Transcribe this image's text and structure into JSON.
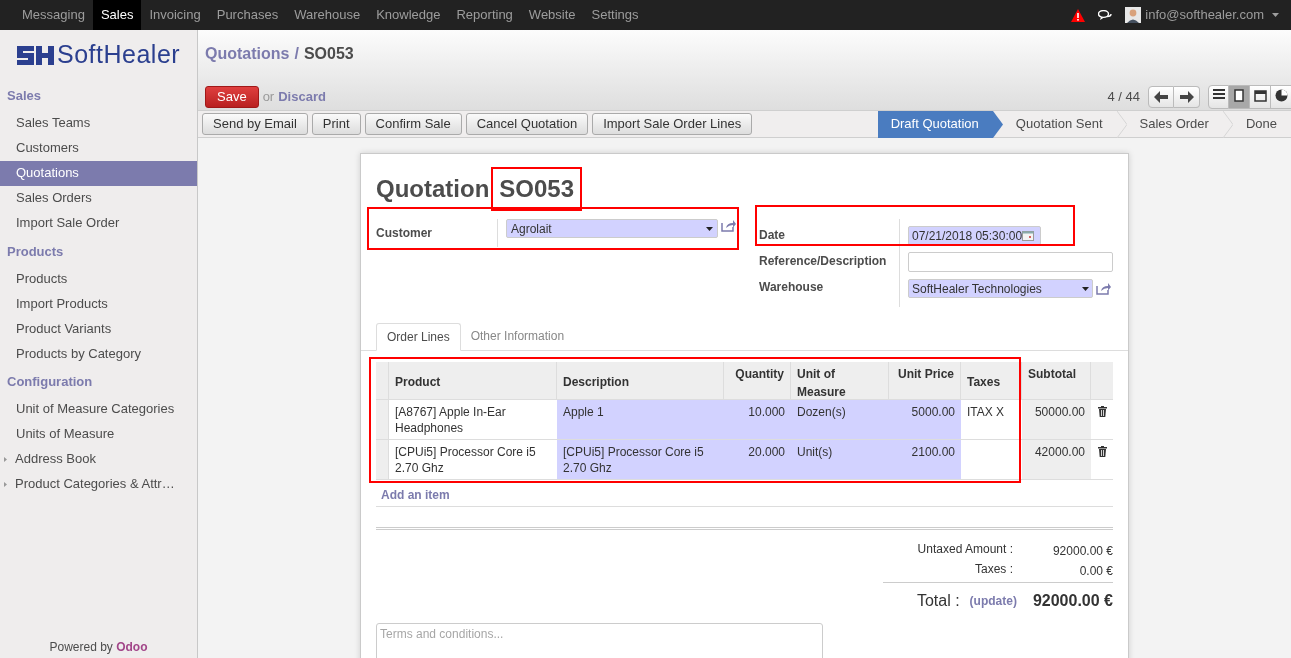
{
  "top_menu": [
    {
      "label": "Messaging",
      "selected": false
    },
    {
      "label": "Sales",
      "selected": true
    },
    {
      "label": "Invoicing",
      "selected": false
    },
    {
      "label": "Purchases",
      "selected": false
    },
    {
      "label": "Warehouse",
      "selected": false
    },
    {
      "label": "Knowledge",
      "selected": false
    },
    {
      "label": "Reporting",
      "selected": false
    },
    {
      "label": "Website",
      "selected": false
    },
    {
      "label": "Settings",
      "selected": false
    }
  ],
  "user": {
    "email": "info@softhealer.com"
  },
  "logo": {
    "text": "SoftHealer"
  },
  "sidebar": {
    "sections": [
      {
        "title": "Sales",
        "items": [
          {
            "label": "Sales Teams",
            "selected": false,
            "kind": "link"
          },
          {
            "label": "Customers",
            "selected": false,
            "kind": "link"
          },
          {
            "label": "Quotations",
            "selected": true,
            "kind": "link"
          },
          {
            "label": "Sales Orders",
            "selected": false,
            "kind": "link"
          },
          {
            "label": "Import Sale Order",
            "selected": false,
            "kind": "link"
          }
        ]
      },
      {
        "title": "Products",
        "items": [
          {
            "label": "Products",
            "selected": false,
            "kind": "link"
          },
          {
            "label": "Import Products",
            "selected": false,
            "kind": "link"
          },
          {
            "label": "Product Variants",
            "selected": false,
            "kind": "link"
          },
          {
            "label": "Products by Category",
            "selected": false,
            "kind": "link"
          }
        ]
      },
      {
        "title": "Configuration",
        "items": [
          {
            "label": "Unit of Measure Categories",
            "selected": false,
            "kind": "link"
          },
          {
            "label": "Units of Measure",
            "selected": false,
            "kind": "link"
          },
          {
            "label": "Address Book",
            "selected": false,
            "kind": "folder"
          },
          {
            "label": "Product Categories & Attr…",
            "selected": false,
            "kind": "folder"
          }
        ]
      }
    ],
    "footer_text": "Powered by",
    "footer_link": "Odoo"
  },
  "breadcrumb": {
    "parent": "Quotations",
    "separator": "/",
    "current": "SO053"
  },
  "actions": {
    "save": "Save",
    "or": "or",
    "discard": "Discard"
  },
  "pager": "4 / 44",
  "views": [
    {
      "kind": "list",
      "selected": false
    },
    {
      "kind": "form",
      "selected": true
    },
    {
      "kind": "calendar",
      "selected": false
    },
    {
      "kind": "graph",
      "selected": false
    }
  ],
  "buttons": [
    "Send by Email",
    "Print",
    "Confirm Sale",
    "Cancel Quotation",
    "Import Sale Order Lines"
  ],
  "stages": [
    {
      "label": "Draft Quotation",
      "selected": true
    },
    {
      "label": "Quotation Sent",
      "selected": false
    },
    {
      "label": "Sales Order",
      "selected": false
    },
    {
      "label": "Done",
      "selected": false
    }
  ],
  "form": {
    "title": "Quotation",
    "number": "SO053",
    "customer": {
      "label": "Customer",
      "value": "Agrolait"
    },
    "date": {
      "label": "Date",
      "value": "07/21/2018 05:30:00"
    },
    "reference": {
      "label": "Reference/Description"
    },
    "warehouse": {
      "label": "Warehouse",
      "value": "SoftHealer Technologies"
    }
  },
  "tabs": [
    {
      "label": "Order Lines",
      "selected": true
    },
    {
      "label": "Other Information",
      "selected": false
    }
  ],
  "table": {
    "columns": [
      "Product",
      "Description",
      "Quantity",
      "Unit of Measure",
      "Unit Price",
      "Taxes",
      "Subtotal"
    ],
    "rows": [
      [
        "[A8767] Apple In-Ear Headphones",
        "Apple 1",
        "10.000",
        "Dozen(s)",
        "5000.00",
        "ITAX X",
        "50000.00"
      ],
      [
        "[CPUi5] Processor Core i5 2.70 Ghz",
        "[CPUi5] Processor Core i5 2.70 Ghz",
        "20.000",
        "Unit(s)",
        "2100.00",
        "",
        "42000.00"
      ]
    ],
    "add_item": "Add an item"
  },
  "totals": {
    "untaxed_label": "Untaxed Amount :",
    "untaxed": "92000.00 €",
    "taxes_label": "Taxes :",
    "taxes": "0.00 €",
    "total_label": "Total :",
    "update": "(update)",
    "total": "92000.00 €"
  },
  "terms": {
    "placeholder": "Terms and conditions..."
  }
}
